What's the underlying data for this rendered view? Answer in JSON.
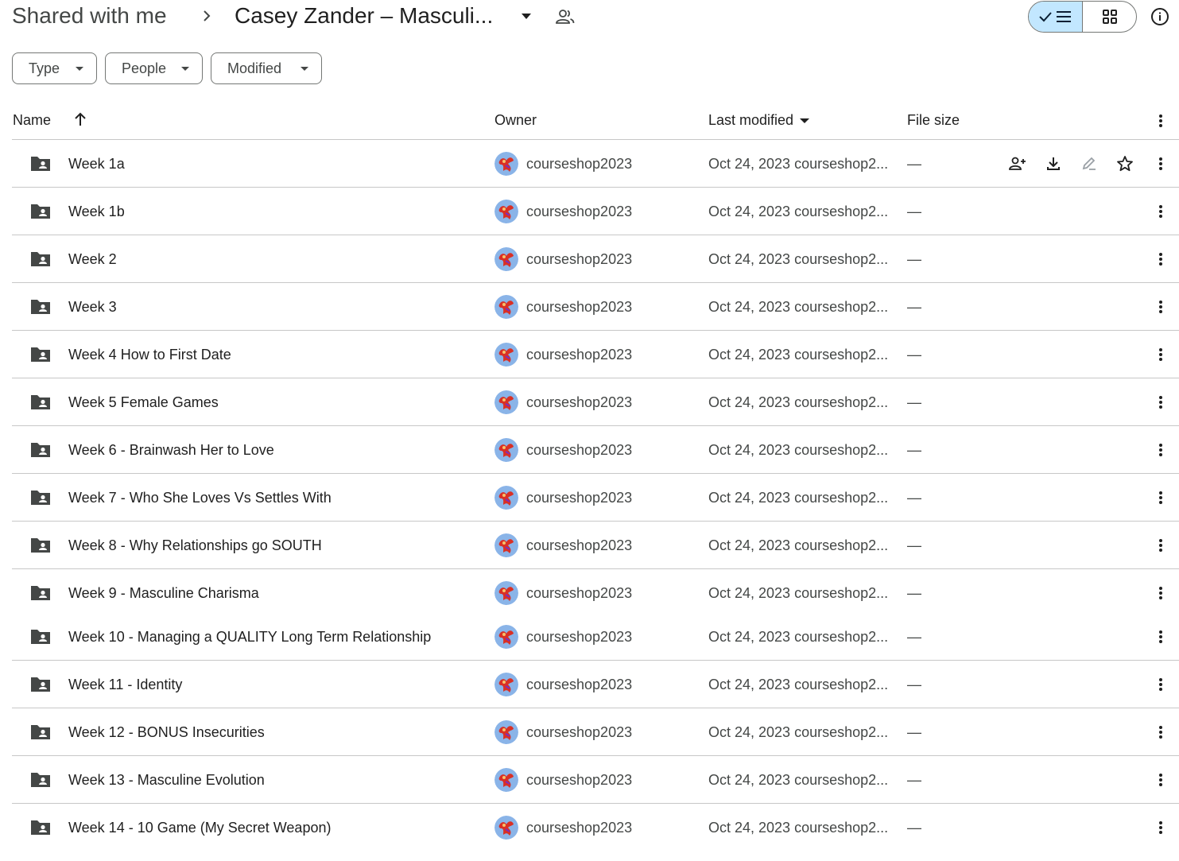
{
  "header": {
    "root_crumb": "Shared with me",
    "current_folder": "Casey Zander – Masculi..."
  },
  "filters": [
    {
      "label": "Type"
    },
    {
      "label": "People"
    },
    {
      "label": "Modified"
    }
  ],
  "table": {
    "col_name": "Name",
    "col_owner": "Owner",
    "col_modified": "Last modified",
    "col_size": "File size"
  },
  "rows": [
    {
      "name": "Week 1a",
      "owner": "courseshop2023",
      "modified": "Oct 24, 2023 courseshop2...",
      "size": "—"
    },
    {
      "name": "Week 1b",
      "owner": "courseshop2023",
      "modified": "Oct 24, 2023 courseshop2...",
      "size": "—"
    },
    {
      "name": "Week 2",
      "owner": "courseshop2023",
      "modified": "Oct 24, 2023 courseshop2...",
      "size": "—"
    },
    {
      "name": "Week 3",
      "owner": "courseshop2023",
      "modified": "Oct 24, 2023 courseshop2...",
      "size": "—"
    },
    {
      "name": "Week 4 How to First Date",
      "owner": "courseshop2023",
      "modified": "Oct 24, 2023 courseshop2...",
      "size": "—"
    },
    {
      "name": "Week 5 Female Games",
      "owner": "courseshop2023",
      "modified": "Oct 24, 2023 courseshop2...",
      "size": "—"
    },
    {
      "name": "Week 6 - Brainwash Her to Love",
      "owner": "courseshop2023",
      "modified": "Oct 24, 2023 courseshop2...",
      "size": "—"
    },
    {
      "name": "Week 7 - Who She Loves Vs Settles With",
      "owner": "courseshop2023",
      "modified": "Oct 24, 2023 courseshop2...",
      "size": "—"
    },
    {
      "name": "Week 8 - Why Relationships go SOUTH",
      "owner": "courseshop2023",
      "modified": "Oct 24, 2023 courseshop2...",
      "size": "—"
    },
    {
      "name": "Week 9 - Masculine Charisma",
      "owner": "courseshop2023",
      "modified": "Oct 24, 2023 courseshop2...",
      "size": "—"
    },
    {
      "name": "Week 10 - Managing a QUALITY Long Term Relationship",
      "owner": "courseshop2023",
      "modified": "Oct 24, 2023 courseshop2...",
      "size": "—"
    },
    {
      "name": "Week 11 - Identity",
      "owner": "courseshop2023",
      "modified": "Oct 24, 2023 courseshop2...",
      "size": "—"
    },
    {
      "name": "Week 12 - BONUS Insecurities",
      "owner": "courseshop2023",
      "modified": "Oct 24, 2023 courseshop2...",
      "size": "—"
    },
    {
      "name": "Week 13 - Masculine Evolution",
      "owner": "courseshop2023",
      "modified": "Oct 24, 2023 courseshop2...",
      "size": "—"
    },
    {
      "name": "Week 14 - 10 Game (My Secret Weapon)",
      "owner": "courseshop2023",
      "modified": "Oct 24, 2023 courseshop2...",
      "size": "—"
    }
  ],
  "icons": {
    "breadcrumb_separator": "chevron-right-icon",
    "folder_dropdown": "caret-down-icon",
    "shared": "people-icon",
    "list_view": "check-list-icon",
    "grid_view": "grid-icon",
    "info": "info-icon",
    "row_folder": "shared-folder-icon",
    "row_actions": [
      "share-icon",
      "download-icon",
      "rename-icon",
      "star-icon"
    ],
    "more": "more-vertical-icon"
  },
  "colors": {
    "accent_selected": "#c2e7ff",
    "divider": "#c7c7c7",
    "icon": "#444746"
  }
}
